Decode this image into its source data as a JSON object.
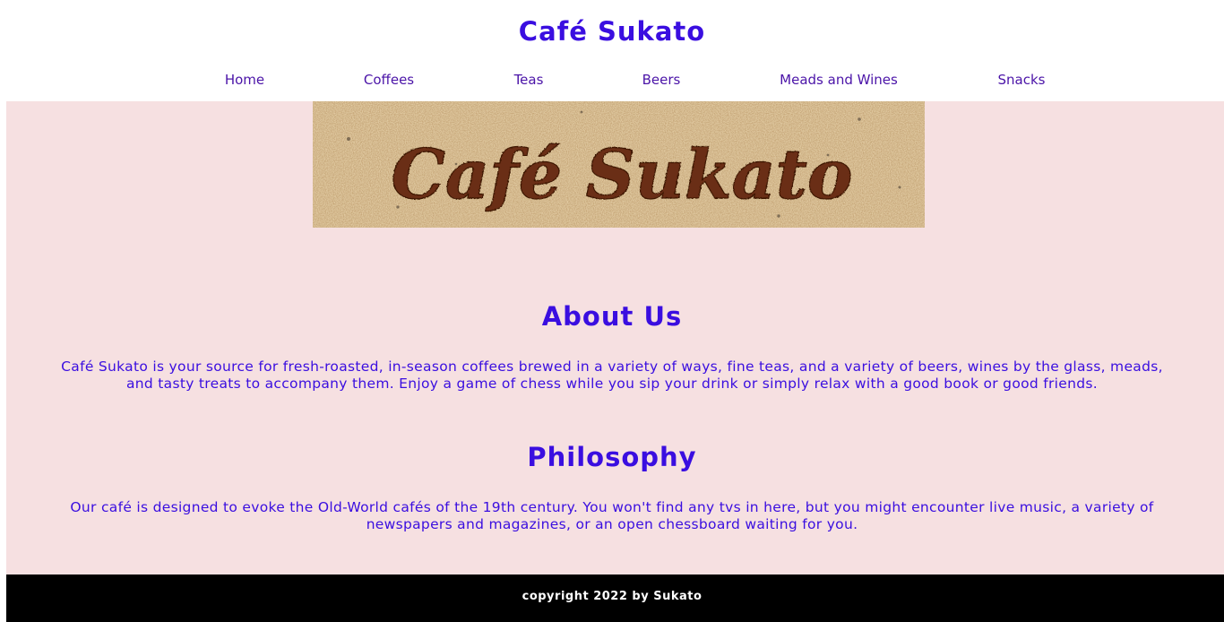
{
  "header": {
    "title": "Café Sukato",
    "nav": [
      "Home",
      "Coffees",
      "Teas",
      "Beers",
      "Meads and Wines",
      "Snacks"
    ]
  },
  "banner": {
    "logo_text": "Café Sukato"
  },
  "about": {
    "heading": "About Us",
    "text": "Café Sukato is your source for fresh-roasted, in-season coffees brewed in a variety of ways, fine teas, and a variety of beers, wines by the glass, meads, and tasty treats to accompany them. Enjoy a game of chess while you sip your drink or simply relax with a good book or good friends."
  },
  "philosophy": {
    "heading": "Philosophy",
    "text": "Our café is designed to evoke the Old-World cafés of the 19th century. You won't find any tvs in here, but you might encounter live music, a variety of newspapers and magazines, or an open chessboard waiting for you."
  },
  "footer": {
    "copyright": "copyright 2022 by Sukato"
  },
  "colors": {
    "accent": "#3a0ee0",
    "nav_text": "#4b14a8",
    "page_background": "#f6e0e1",
    "footer_background": "#000000",
    "logo_brown": "#6b2e12"
  }
}
